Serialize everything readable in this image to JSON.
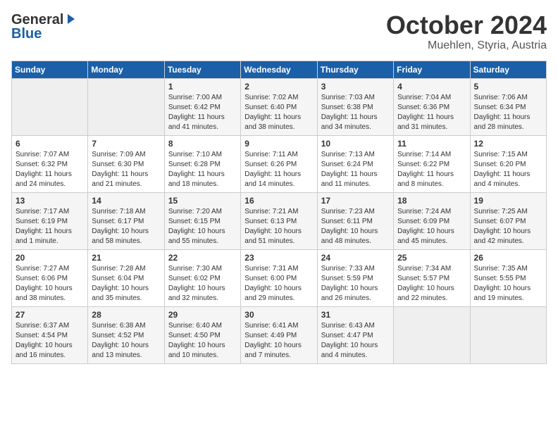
{
  "header": {
    "logo_general": "General",
    "logo_blue": "Blue",
    "title": "October 2024",
    "subtitle": "Muehlen, Styria, Austria"
  },
  "weekdays": [
    "Sunday",
    "Monday",
    "Tuesday",
    "Wednesday",
    "Thursday",
    "Friday",
    "Saturday"
  ],
  "rows": [
    [
      {
        "day": "",
        "info": ""
      },
      {
        "day": "",
        "info": ""
      },
      {
        "day": "1",
        "info": "Sunrise: 7:00 AM\nSunset: 6:42 PM\nDaylight: 11 hours and 41 minutes."
      },
      {
        "day": "2",
        "info": "Sunrise: 7:02 AM\nSunset: 6:40 PM\nDaylight: 11 hours and 38 minutes."
      },
      {
        "day": "3",
        "info": "Sunrise: 7:03 AM\nSunset: 6:38 PM\nDaylight: 11 hours and 34 minutes."
      },
      {
        "day": "4",
        "info": "Sunrise: 7:04 AM\nSunset: 6:36 PM\nDaylight: 11 hours and 31 minutes."
      },
      {
        "day": "5",
        "info": "Sunrise: 7:06 AM\nSunset: 6:34 PM\nDaylight: 11 hours and 28 minutes."
      }
    ],
    [
      {
        "day": "6",
        "info": "Sunrise: 7:07 AM\nSunset: 6:32 PM\nDaylight: 11 hours and 24 minutes."
      },
      {
        "day": "7",
        "info": "Sunrise: 7:09 AM\nSunset: 6:30 PM\nDaylight: 11 hours and 21 minutes."
      },
      {
        "day": "8",
        "info": "Sunrise: 7:10 AM\nSunset: 6:28 PM\nDaylight: 11 hours and 18 minutes."
      },
      {
        "day": "9",
        "info": "Sunrise: 7:11 AM\nSunset: 6:26 PM\nDaylight: 11 hours and 14 minutes."
      },
      {
        "day": "10",
        "info": "Sunrise: 7:13 AM\nSunset: 6:24 PM\nDaylight: 11 hours and 11 minutes."
      },
      {
        "day": "11",
        "info": "Sunrise: 7:14 AM\nSunset: 6:22 PM\nDaylight: 11 hours and 8 minutes."
      },
      {
        "day": "12",
        "info": "Sunrise: 7:15 AM\nSunset: 6:20 PM\nDaylight: 11 hours and 4 minutes."
      }
    ],
    [
      {
        "day": "13",
        "info": "Sunrise: 7:17 AM\nSunset: 6:19 PM\nDaylight: 11 hours and 1 minute."
      },
      {
        "day": "14",
        "info": "Sunrise: 7:18 AM\nSunset: 6:17 PM\nDaylight: 10 hours and 58 minutes."
      },
      {
        "day": "15",
        "info": "Sunrise: 7:20 AM\nSunset: 6:15 PM\nDaylight: 10 hours and 55 minutes."
      },
      {
        "day": "16",
        "info": "Sunrise: 7:21 AM\nSunset: 6:13 PM\nDaylight: 10 hours and 51 minutes."
      },
      {
        "day": "17",
        "info": "Sunrise: 7:23 AM\nSunset: 6:11 PM\nDaylight: 10 hours and 48 minutes."
      },
      {
        "day": "18",
        "info": "Sunrise: 7:24 AM\nSunset: 6:09 PM\nDaylight: 10 hours and 45 minutes."
      },
      {
        "day": "19",
        "info": "Sunrise: 7:25 AM\nSunset: 6:07 PM\nDaylight: 10 hours and 42 minutes."
      }
    ],
    [
      {
        "day": "20",
        "info": "Sunrise: 7:27 AM\nSunset: 6:06 PM\nDaylight: 10 hours and 38 minutes."
      },
      {
        "day": "21",
        "info": "Sunrise: 7:28 AM\nSunset: 6:04 PM\nDaylight: 10 hours and 35 minutes."
      },
      {
        "day": "22",
        "info": "Sunrise: 7:30 AM\nSunset: 6:02 PM\nDaylight: 10 hours and 32 minutes."
      },
      {
        "day": "23",
        "info": "Sunrise: 7:31 AM\nSunset: 6:00 PM\nDaylight: 10 hours and 29 minutes."
      },
      {
        "day": "24",
        "info": "Sunrise: 7:33 AM\nSunset: 5:59 PM\nDaylight: 10 hours and 26 minutes."
      },
      {
        "day": "25",
        "info": "Sunrise: 7:34 AM\nSunset: 5:57 PM\nDaylight: 10 hours and 22 minutes."
      },
      {
        "day": "26",
        "info": "Sunrise: 7:35 AM\nSunset: 5:55 PM\nDaylight: 10 hours and 19 minutes."
      }
    ],
    [
      {
        "day": "27",
        "info": "Sunrise: 6:37 AM\nSunset: 4:54 PM\nDaylight: 10 hours and 16 minutes."
      },
      {
        "day": "28",
        "info": "Sunrise: 6:38 AM\nSunset: 4:52 PM\nDaylight: 10 hours and 13 minutes."
      },
      {
        "day": "29",
        "info": "Sunrise: 6:40 AM\nSunset: 4:50 PM\nDaylight: 10 hours and 10 minutes."
      },
      {
        "day": "30",
        "info": "Sunrise: 6:41 AM\nSunset: 4:49 PM\nDaylight: 10 hours and 7 minutes."
      },
      {
        "day": "31",
        "info": "Sunrise: 6:43 AM\nSunset: 4:47 PM\nDaylight: 10 hours and 4 minutes."
      },
      {
        "day": "",
        "info": ""
      },
      {
        "day": "",
        "info": ""
      }
    ]
  ]
}
